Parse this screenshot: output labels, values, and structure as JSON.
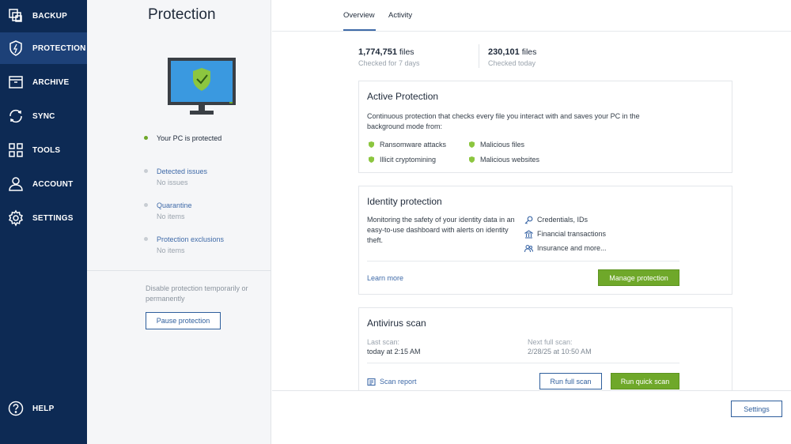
{
  "nav": {
    "items": [
      {
        "label": "BACKUP",
        "icon": "backup-icon"
      },
      {
        "label": "PROTECTION",
        "icon": "shield-icon",
        "active": true
      },
      {
        "label": "ARCHIVE",
        "icon": "archive-icon"
      },
      {
        "label": "SYNC",
        "icon": "sync-icon"
      },
      {
        "label": "TOOLS",
        "icon": "tools-grid-icon"
      },
      {
        "label": "ACCOUNT",
        "icon": "account-icon"
      },
      {
        "label": "SETTINGS",
        "icon": "gear-icon"
      }
    ],
    "help": {
      "label": "HELP",
      "icon": "help-icon"
    }
  },
  "side": {
    "title": "Protection",
    "status": "Your PC is protected",
    "detected_issues": {
      "label": "Detected issues",
      "value": "No issues"
    },
    "quarantine": {
      "label": "Quarantine",
      "value": "No items"
    },
    "exclusions": {
      "label": "Protection exclusions",
      "value": "No items"
    },
    "disable_text": "Disable protection temporarily or permanently",
    "pause_button": "Pause protection"
  },
  "tabs": {
    "overview": "Overview",
    "activity": "Activity"
  },
  "stats": {
    "checked_total": {
      "number": "1,774,751",
      "unit": "files",
      "sub": "Checked for 7 days"
    },
    "checked_today": {
      "number": "230,101",
      "unit": "files",
      "sub": "Checked today"
    }
  },
  "active_protection": {
    "title": "Active Protection",
    "description": "Continuous protection that checks every file you interact with and saves your PC in the background mode from:",
    "features": [
      "Ransomware attacks",
      "Malicious files",
      "Illicit cryptomining",
      "Malicious websites"
    ]
  },
  "identity": {
    "title": "Identity protection",
    "description": "Monitoring the safety of your identity data in an easy-to-use dashboard with alerts on identity theft.",
    "features": [
      "Credentials, IDs",
      "Financial transactions",
      "Insurance and more..."
    ],
    "learn_more": "Learn more",
    "manage_button": "Manage protection"
  },
  "antivirus": {
    "title": "Antivirus scan",
    "last_scan_label": "Last scan:",
    "last_scan_value": "today at 2:15 AM",
    "next_scan_label": "Next full scan:",
    "next_scan_value": "2/28/25 at 10:50 AM",
    "scan_report": "Scan report",
    "full_scan_button": "Run full scan",
    "quick_scan_button": "Run quick scan"
  },
  "footer": {
    "settings_button": "Settings"
  },
  "colors": {
    "nav_bg": "#0d2a54",
    "nav_active": "#1d4178",
    "accent_blue": "#3f6aa8",
    "accent_green": "#6fa82a"
  }
}
